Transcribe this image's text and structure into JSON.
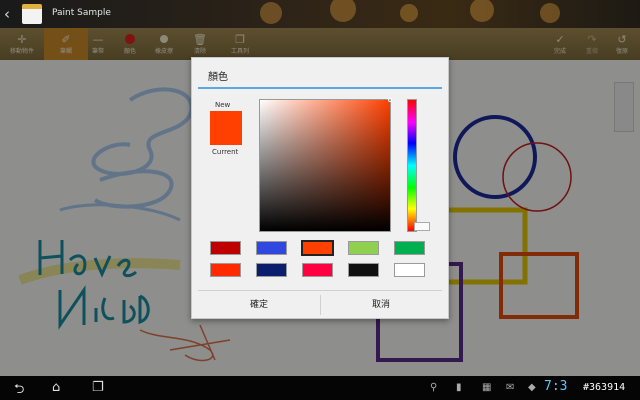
{
  "titlebar": {
    "app_title": "Paint Sample"
  },
  "toolbar": {
    "tools": [
      {
        "label": "移動物件"
      },
      {
        "label": "筆觸"
      },
      {
        "label": "筆幣"
      },
      {
        "label": "顏色"
      },
      {
        "label": "橡皮擦"
      },
      {
        "label": "清除"
      },
      {
        "label": "工具列"
      },
      {
        "label": "完成"
      },
      {
        "label": "重做"
      },
      {
        "label": "復原"
      }
    ]
  },
  "dialog": {
    "title": "顏色",
    "new_label": "New",
    "current_label": "Current",
    "current_color": "#ff4000",
    "swatches": [
      "#c00000",
      "#3048e0",
      "#ff4000",
      "#90d050",
      "#00b050",
      "#ff2a00",
      "#0a1e6e",
      "#ff0040",
      "#101010",
      "#ffffff"
    ],
    "ok_label": "確定",
    "cancel_label": "取消"
  },
  "statusbar": {
    "clock": "7:3",
    "watermark": "#363914"
  }
}
